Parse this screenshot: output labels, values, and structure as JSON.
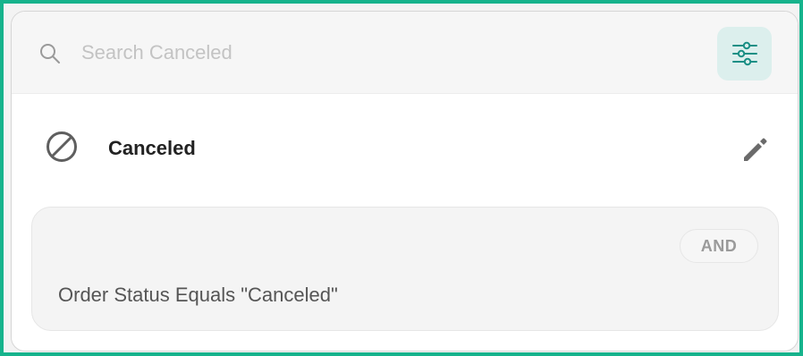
{
  "search": {
    "placeholder": "Search Canceled",
    "icon": "search-icon"
  },
  "toolbar": {
    "filter_icon": "sliders-icon",
    "accent_color": "#1a8f85"
  },
  "status": {
    "label": "Canceled",
    "icon": "block-icon",
    "edit_icon": "pencil-icon"
  },
  "condition": {
    "operator": "AND",
    "text": "Order Status Equals \"Canceled\""
  },
  "frame": {
    "border_color": "#16b38c"
  }
}
